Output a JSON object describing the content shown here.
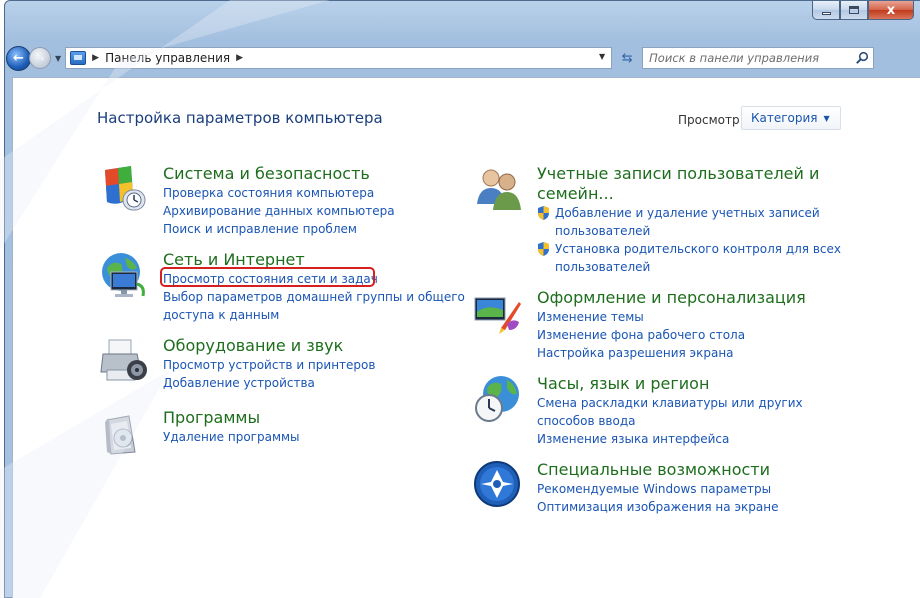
{
  "window": {
    "close_glyph": "x"
  },
  "nav": {
    "breadcrumb": "Панель управления",
    "search_placeholder": "Поиск в панели управления"
  },
  "page": {
    "title": "Настройка параметров компьютера",
    "view_label": "Просмотр:",
    "view_value": "Категория"
  },
  "categories_left": [
    {
      "title": "Система и безопасность",
      "icon": "shield-icon",
      "links": [
        "Проверка состояния компьютера",
        "Архивирование данных компьютера",
        "Поиск и исправление проблем"
      ]
    },
    {
      "title": "Сеть и Интернет",
      "icon": "network-icon",
      "links": [
        "Просмотр состояния сети и задач",
        "Выбор параметров домашней группы и общего",
        "доступа к данным"
      ]
    },
    {
      "title": "Оборудование и звук",
      "icon": "printer-icon",
      "links": [
        "Просмотр устройств и принтеров",
        "Добавление устройства"
      ]
    },
    {
      "title": "Программы",
      "icon": "programs-icon",
      "links": [
        "Удаление программы"
      ]
    }
  ],
  "categories_right": [
    {
      "title_line1": "Учетные записи пользователей и",
      "title_line2": "семейн...",
      "icon": "users-icon",
      "links": [
        "Добавление и удаление учетных записей",
        "пользователей",
        "Установка родительского контроля для всех",
        "пользователей"
      ]
    },
    {
      "title": "Оформление и персонализация",
      "icon": "personalization-icon",
      "links": [
        "Изменение темы",
        "Изменение фона рабочего стола",
        "Настройка разрешения экрана"
      ]
    },
    {
      "title": "Часы, язык и регион",
      "icon": "clock-globe-icon",
      "links": [
        "Смена раскладки клавиатуры или других",
        "способов ввода",
        "Изменение языка интерфейса"
      ]
    },
    {
      "title": "Специальные возможности",
      "icon": "accessibility-icon",
      "links": [
        "Рекомендуемые Windows параметры",
        "Оптимизация изображения на экране"
      ]
    }
  ],
  "colors": {
    "link": "#1a55b5",
    "category_title": "#1e6e1e",
    "page_title": "#1a3e7c",
    "highlight": "#d62020"
  }
}
